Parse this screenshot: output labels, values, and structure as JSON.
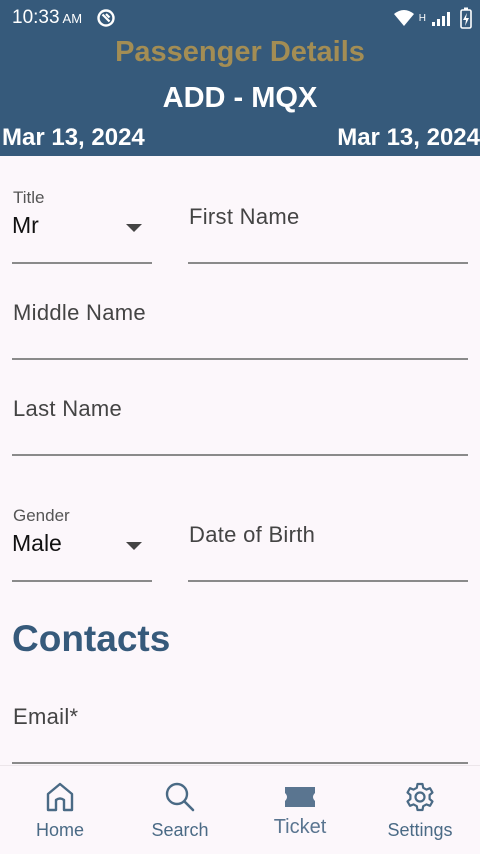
{
  "status_bar": {
    "time": "10:33",
    "ampm": "AM",
    "network_type": "H"
  },
  "header": {
    "title": "Passenger Details",
    "route": "ADD - MQX",
    "date_left": "Mar 13, 2024",
    "date_right": "Mar 13, 2024"
  },
  "form": {
    "title_field": {
      "label": "Title",
      "value": "Mr"
    },
    "first_name": {
      "label": "First Name"
    },
    "middle_name": {
      "label": "Middle Name"
    },
    "last_name": {
      "label": "Last Name"
    },
    "gender_field": {
      "label": "Gender",
      "value": "Male"
    },
    "date_of_birth": {
      "label": "Date of Birth"
    },
    "contacts_heading": "Contacts",
    "email": {
      "label": "Email*"
    }
  },
  "nav": {
    "items": [
      {
        "label": "Home",
        "icon": "home-icon"
      },
      {
        "label": "Search",
        "icon": "search-icon"
      },
      {
        "label": "Ticket",
        "icon": "ticket-icon",
        "active": true
      },
      {
        "label": "Settings",
        "icon": "gear-icon"
      }
    ]
  },
  "colors": {
    "header_bg": "#365a7b",
    "title_gold": "#a38d54",
    "accent": "#365a7b"
  }
}
